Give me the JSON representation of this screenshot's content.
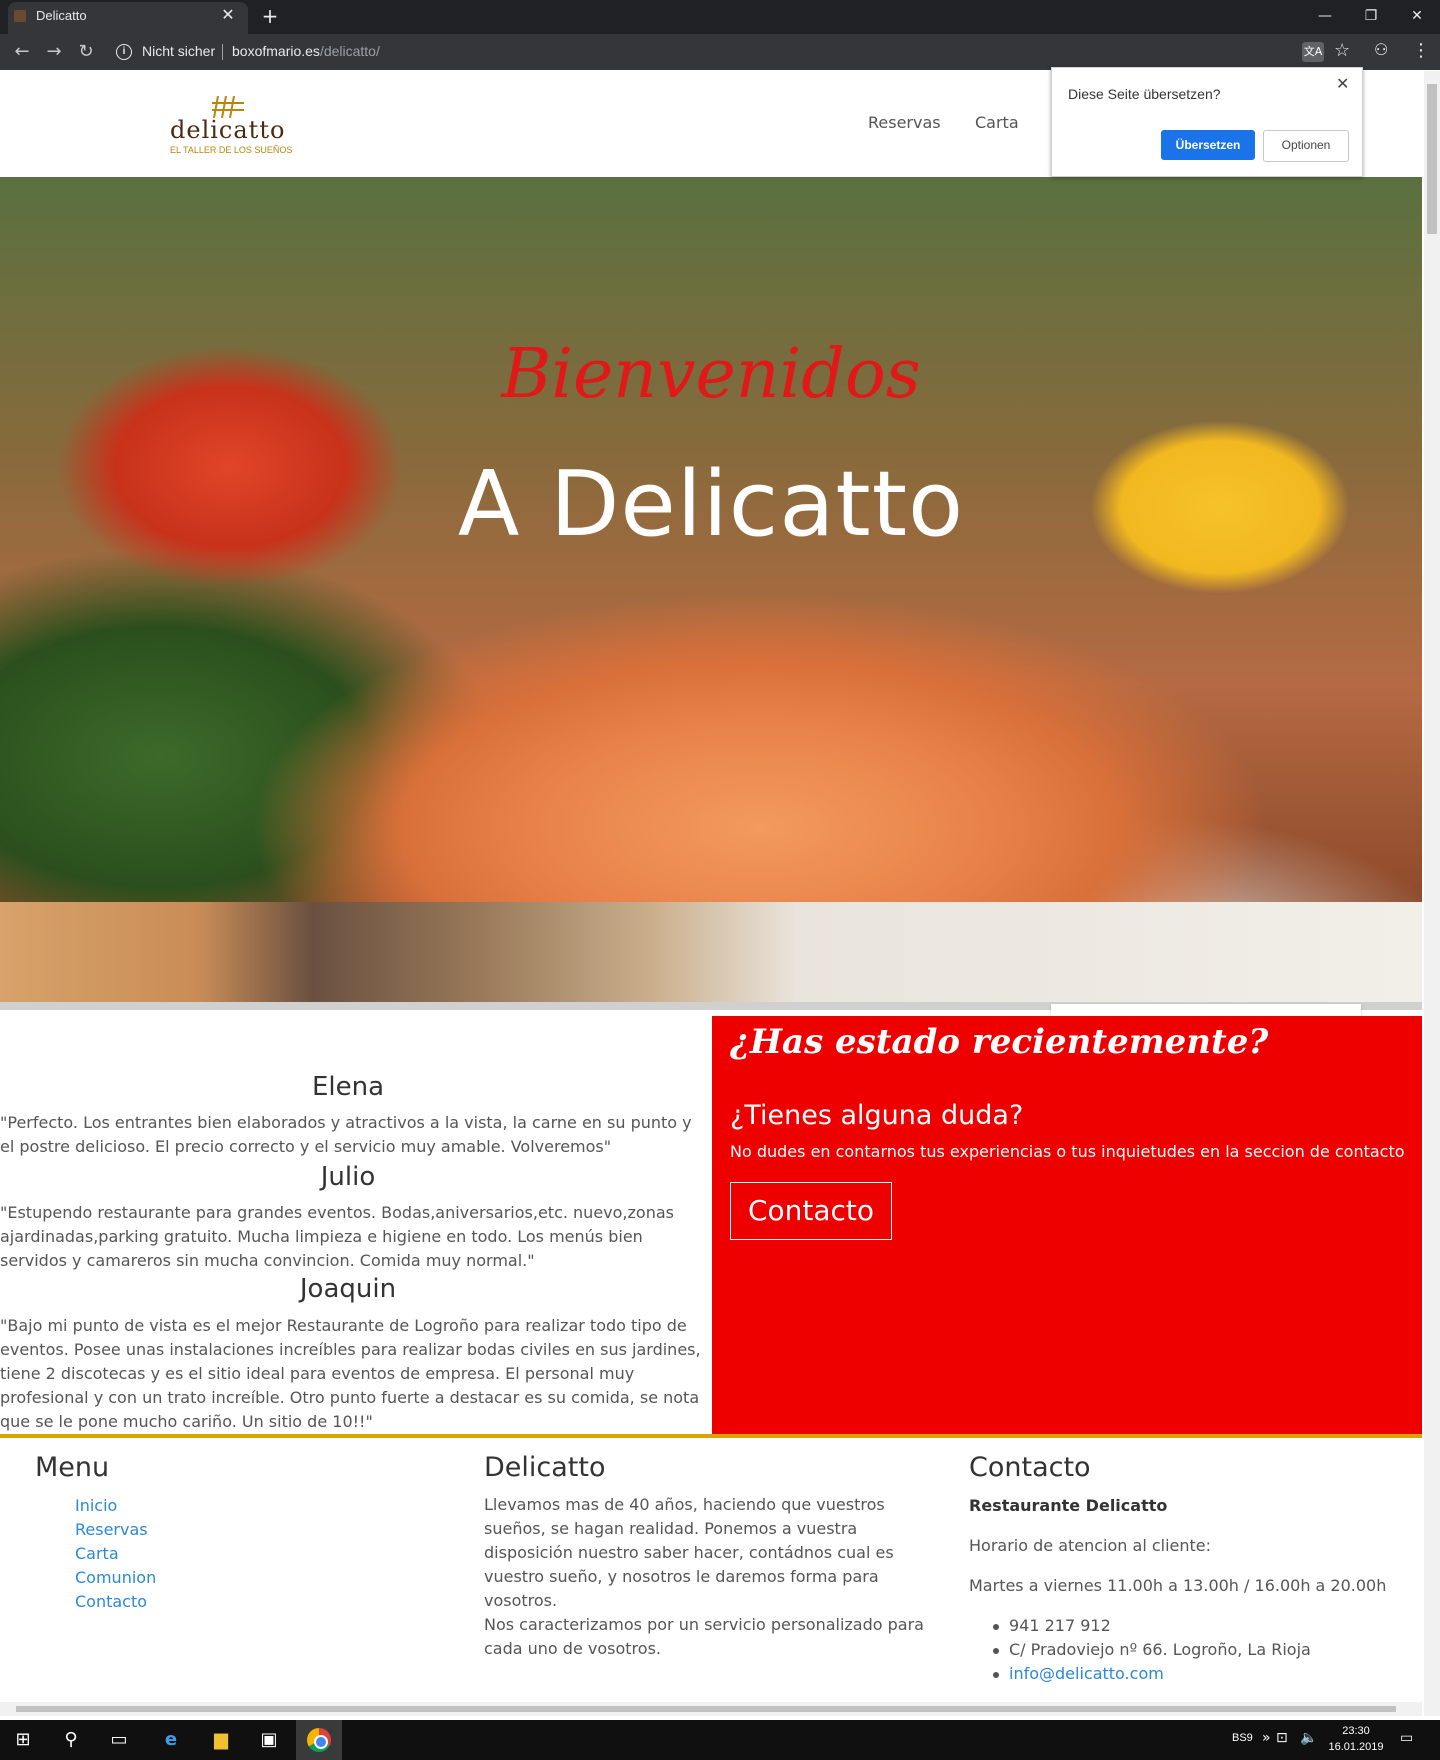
{
  "browser": {
    "tab_title": "Delicatto",
    "tab_close": "✕",
    "new_tab": "+",
    "address": {
      "security_label": "Nicht sicher",
      "host": "boxofmario.es",
      "path": "/delicatto/"
    },
    "window_controls": {
      "minimize": "—",
      "restore": "❐",
      "close": "✕"
    }
  },
  "translate_popup": {
    "prompt": "Diese Seite übersetzen?",
    "translate_button": "Übersetzen",
    "options_button": "Optionen",
    "close": "✕"
  },
  "header": {
    "logo_word": "delicatto",
    "logo_tagline": "EL TALLER DE LOS SUEÑOS",
    "nav": [
      {
        "label": "Reservas"
      },
      {
        "label": "Carta"
      }
    ]
  },
  "hero": {
    "line1": "Bienvenidos",
    "line2": "A Delicatto"
  },
  "reviews": [
    {
      "name": "Elena",
      "text": "\"Perfecto. Los entrantes bien elaborados y atractivos a la vista, la carne en su punto y el postre delicioso. El precio correcto y el servicio muy amable. Volveremos\""
    },
    {
      "name": "Julio",
      "text": "\"Estupendo restaurante para grandes eventos. Bodas,aniversarios,etc. nuevo,zonas ajardinadas,parking gratuito. Mucha limpieza e higiene en todo. Los menús bien servidos y camareros sin mucha convincion. Comida muy normal.\""
    },
    {
      "name": "Joaquin",
      "text": "\"Bajo mi punto de vista es el mejor Restaurante de Logroño para realizar todo tipo de eventos. Posee unas instalaciones increíbles para realizar bodas civiles en sus jardines, tiene 2 discotecas y es el sitio ideal para eventos de empresa. El personal muy profesional y con un trato increíble. Otro punto fuerte a destacar es su comida, se nota que se le pone mucho cariño. Un sitio de 10!!\""
    }
  ],
  "cta": {
    "title": "¿Has estado recientemente?",
    "question": "¿Tienes alguna duda?",
    "text": "No dudes en contarnos tus experiencias o tus inquietudes en la seccion de contacto",
    "button": "Contacto"
  },
  "footer": {
    "menu_heading": "Menu",
    "menu_links": [
      "Inicio",
      "Reservas",
      "Carta",
      "Comunion",
      "Contacto"
    ],
    "about_heading": "Delicatto",
    "about_p1": "Llevamos mas de 40 años, haciendo que vuestros sueños, se hagan realidad. Ponemos a vuestra disposición nuestro saber hacer, contádnos cual es vuestro sueño, y nosotros le daremos forma para vosotros.",
    "about_p2": "Nos caracterizamos por un servicio personalizado para cada uno de vosotros.",
    "contact_heading": "Contacto",
    "restaurant_name": "Restaurante Delicatto",
    "hours_label": "Horario de atencion al cliente:",
    "hours": "Martes a viernes 11.00h a 13.00h / 16.00h a 20.00h",
    "phone": "941 217 912",
    "address": "C/ Pradoviejo nº 66. Logroño, La Rioja",
    "email": "info@delicatto.com"
  },
  "taskbar": {
    "lang": "BS9",
    "time": "23:30",
    "date": "16.01.2019"
  },
  "colors": {
    "accent_red": "#ee0000",
    "gold": "#d9a300",
    "link_blue": "#2a88d8",
    "chrome_dark": "#202124"
  }
}
